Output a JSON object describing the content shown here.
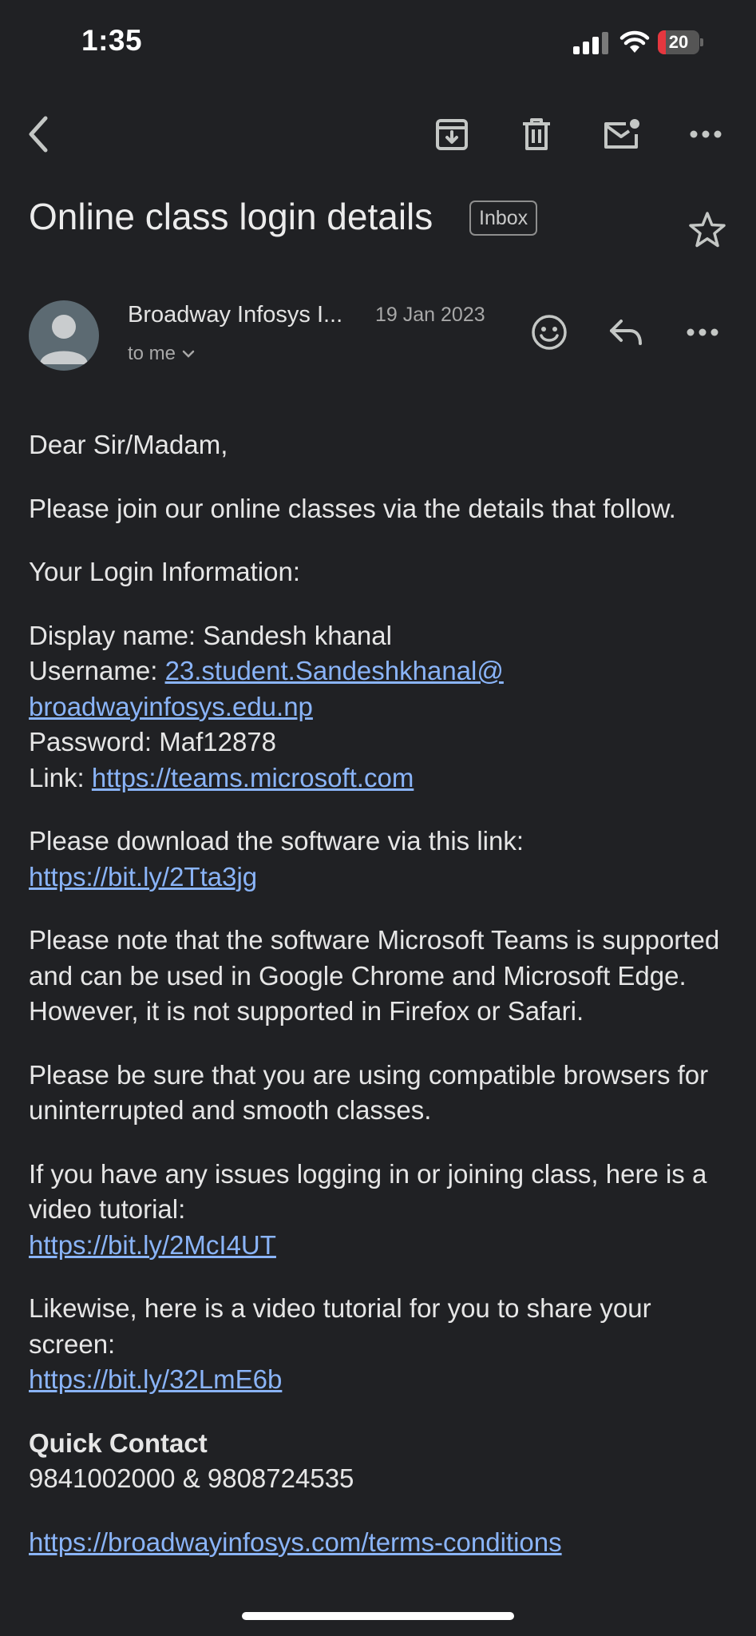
{
  "status_bar": {
    "time": "1:35",
    "battery": "20",
    "battery_level_percent": 20
  },
  "toolbar": {
    "back_icon": "chevron-left-icon",
    "archive_icon": "archive-icon",
    "delete_icon": "trash-icon",
    "mark_unread_icon": "mail-unread-icon",
    "more_icon": "more-horizontal-icon"
  },
  "email": {
    "subject": "Online class login details",
    "label": "Inbox",
    "sender_name": "Broadway Infosys I...",
    "date": "19 Jan 2023",
    "recipient": "to me",
    "greeting": "Dear Sir/Madam,",
    "intro": "Please join our online classes via the details that follow.",
    "login_heading": "Your Login Information:",
    "display_name_label": "Display name: Sandesh khanal",
    "username_label": "Username: ",
    "username_link_1": "23.student.Sandeshkhanal@",
    "username_link_2": "broadwayinfosys.edu.np",
    "password_label": "Password: Maf12878",
    "link_label": "Link: ",
    "teams_link": "https://teams.microsoft.com",
    "download_text": "Please download the software via this link:",
    "download_link": "https://bit.ly/2Tta3jg",
    "note_text": "Please note that the software Microsoft Teams is supported and can be used in Google Chrome and Microsoft Edge. However, it is not supported in Firefox or Safari.",
    "compat_text": "Please be sure that you are using compatible browsers for uninterrupted and smooth classes.",
    "issues_text": "If you have any issues logging in or joining class, here is a video tutorial:",
    "issues_link": "https://bit.ly/2McI4UT",
    "share_text": "Likewise, here is a video tutorial for you to share your screen:",
    "share_link": "https://bit.ly/32LmE6b",
    "quick_contact_heading": "Quick Contact",
    "quick_contact_numbers": "9841002000 & 9808724535",
    "terms_link": "https://broadwayinfosys.com/terms-conditions"
  },
  "colors": {
    "background": "#202124",
    "link": "#8ab4f8",
    "battery_low": "#e5373f"
  }
}
